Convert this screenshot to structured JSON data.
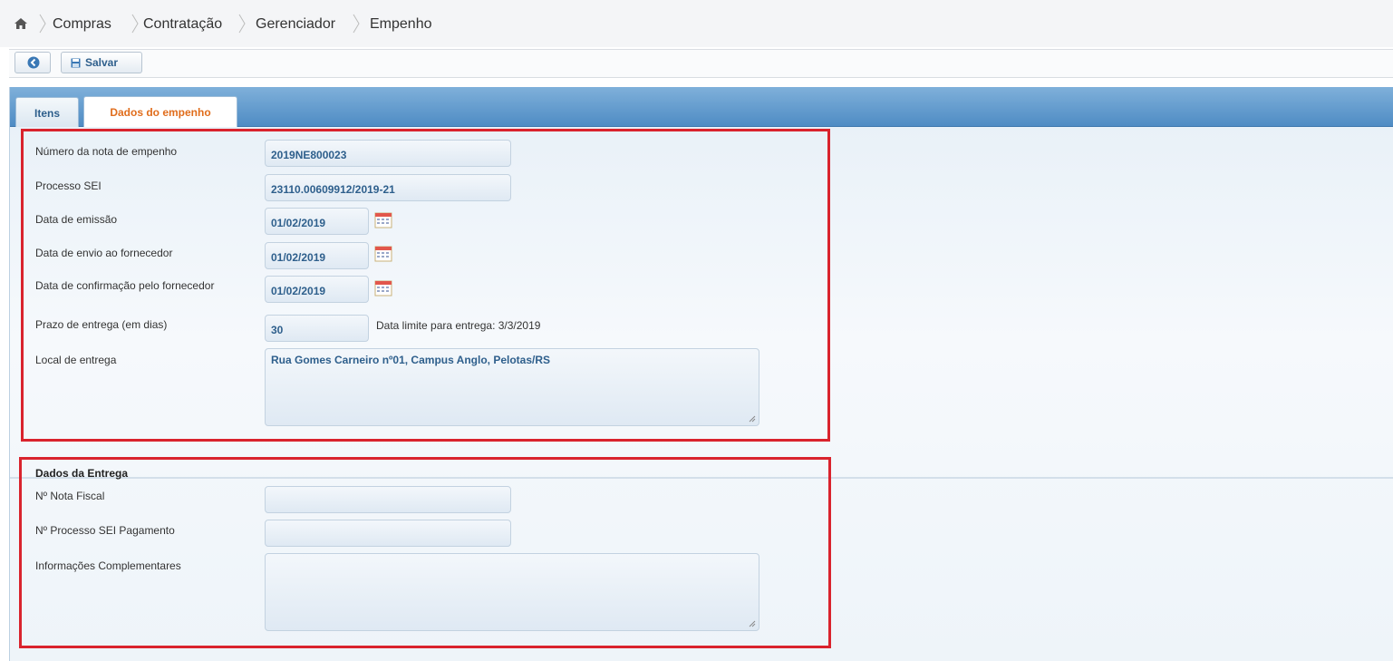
{
  "breadcrumb": {
    "items": [
      "Compras",
      "Contratação",
      "Gerenciador",
      "Empenho"
    ]
  },
  "toolbar": {
    "save_label": "Salvar"
  },
  "tabs": [
    {
      "label": "Itens",
      "active": false
    },
    {
      "label": "Dados do empenho",
      "active": true
    }
  ],
  "empenho": {
    "numero_label": "Número da nota de empenho",
    "numero_value": "2019NE800023",
    "processo_label": "Processo SEI",
    "processo_value": "23110.00609912/2019-21",
    "emissao_label": "Data de emissão",
    "emissao_value": "01/02/2019",
    "envio_label": "Data de envio ao fornecedor",
    "envio_value": "01/02/2019",
    "confirmacao_label": "Data de confirmação pelo fornecedor",
    "confirmacao_value": "01/02/2019",
    "prazo_label": "Prazo de entrega (em dias)",
    "prazo_value": "30",
    "data_limite_text": "Data limite para entrega: 3/3/2019",
    "local_label": "Local de entrega",
    "local_value": "Rua Gomes Carneiro nº01, Campus Anglo, Pelotas/RS"
  },
  "entrega": {
    "title": "Dados da Entrega",
    "nota_fiscal_label": "Nº Nota Fiscal",
    "nota_fiscal_value": "",
    "processo_pagamento_label": "Nº Processo SEI Pagamento",
    "processo_pagamento_value": "",
    "info_label": "Informações Complementares",
    "info_value": ""
  },
  "colors": {
    "accent": "#2e5f8c",
    "active_tab": "#e06d1c",
    "highlight_box": "#d9232d"
  }
}
